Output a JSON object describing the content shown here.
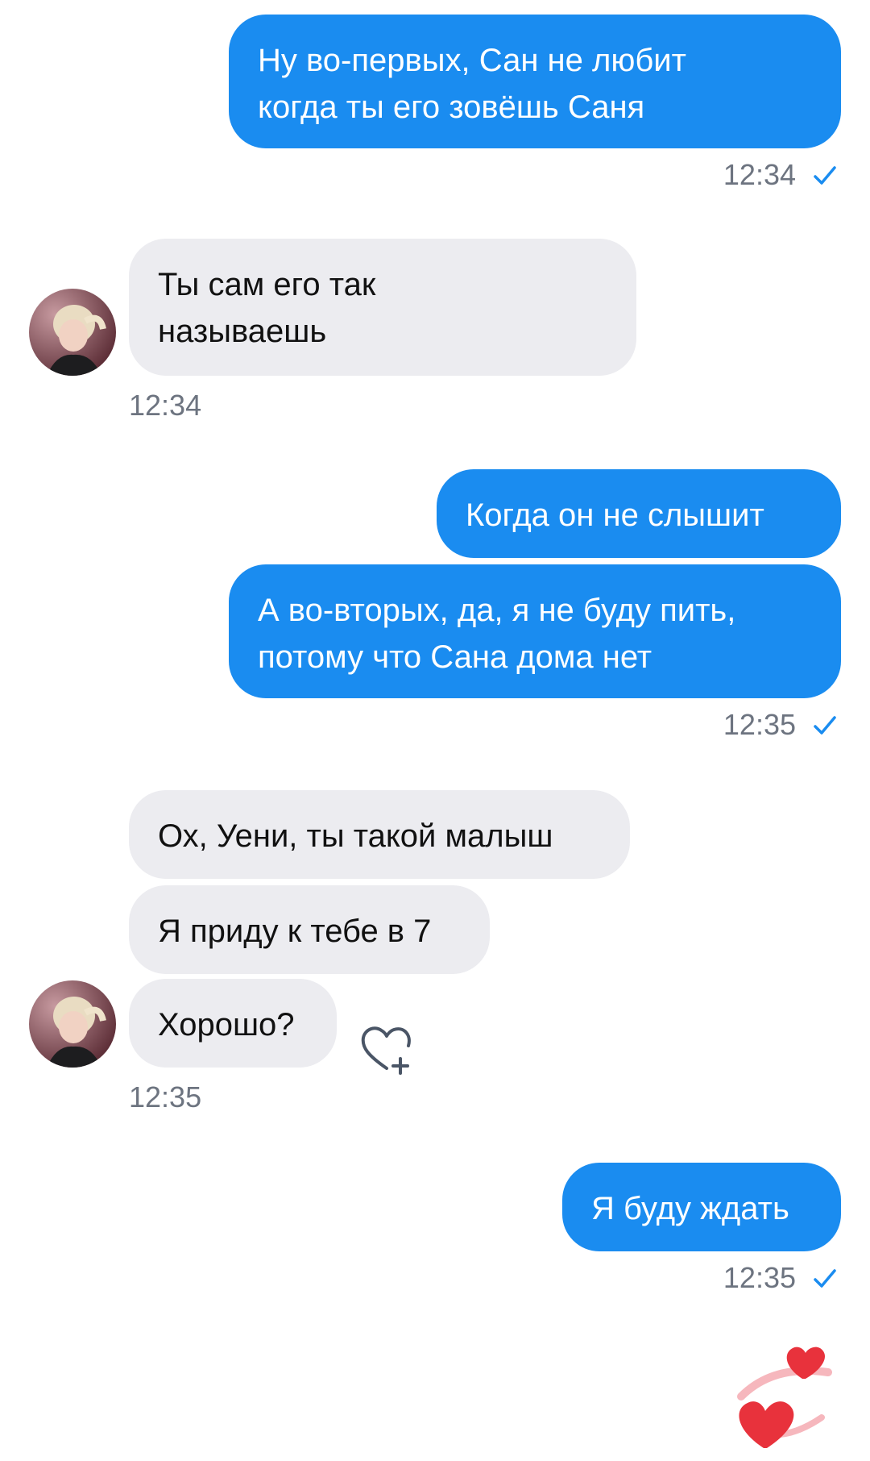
{
  "messages": [
    {
      "text": "Ну во-первых, Сан не любит\nкогда ты его зовёшь Саня"
    },
    {
      "text": "Ты сам его так\nназываешь"
    },
    {
      "text": "Когда он не слышит"
    },
    {
      "text": "А во-вторых, да, я не буду пить,\nпотому что Сана дома нет"
    },
    {
      "text": "Ох, Уени, ты такой малыш"
    },
    {
      "text": "Я приду к тебе в 7"
    },
    {
      "text": "Хорошо?"
    },
    {
      "text": "Я буду ждать"
    }
  ],
  "timestamps": [
    "12:34",
    "12:34",
    "12:35",
    "12:35",
    "12:35"
  ],
  "icons": {
    "read_check": "check-icon",
    "react": "heart-plus-icon",
    "floating": "hearts-icon"
  },
  "colors": {
    "outgoing_bubble": "#1a8cf0",
    "incoming_bubble": "#ececf0",
    "timestamp": "#6d7480",
    "heart": "#e8323c"
  }
}
